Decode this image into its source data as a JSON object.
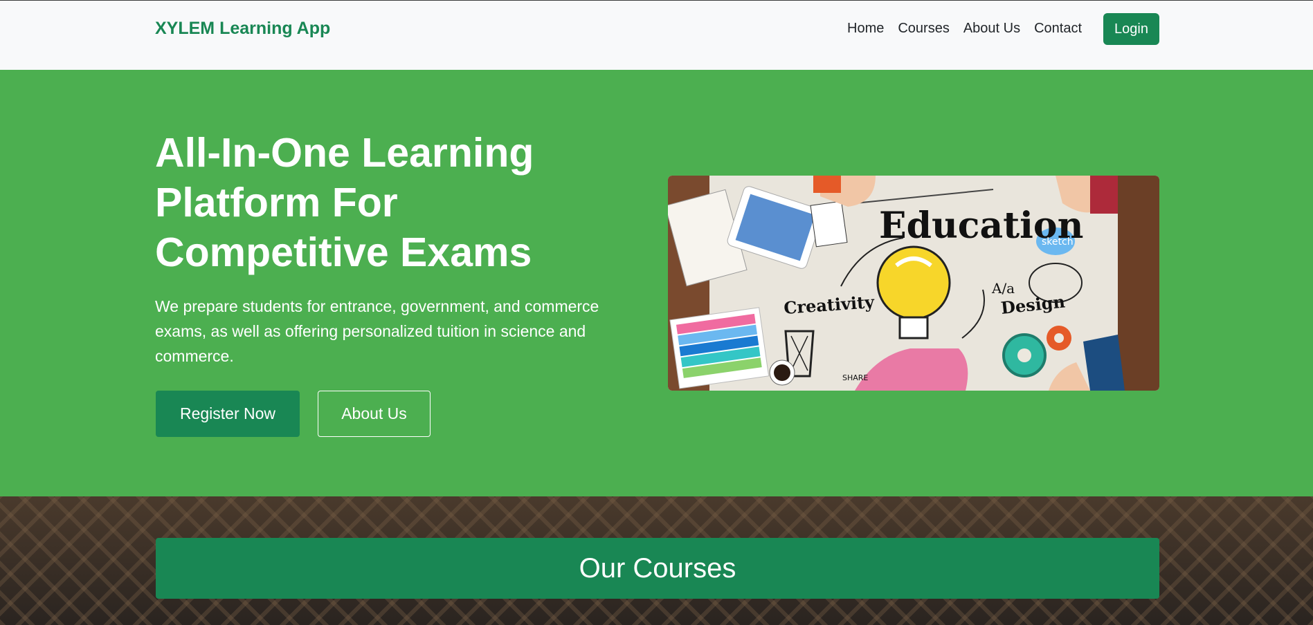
{
  "navbar": {
    "brand": "XYLEM Learning App",
    "links": [
      "Home",
      "Courses",
      "About Us",
      "Contact"
    ],
    "login_label": "Login"
  },
  "hero": {
    "title": "All-In-One Learning Platform For Competitive Exams",
    "description": "We prepare students for entrance, government, and commerce exams, as well as offering personalized tuition in science and commerce.",
    "register_label": "Register Now",
    "about_label": "About Us",
    "image": {
      "heading": "Education",
      "labels": [
        "Creativity",
        "Design",
        "sketch",
        "A/a",
        "SHARE"
      ]
    }
  },
  "courses": {
    "heading": "Our Courses"
  },
  "colors": {
    "brand_green": "#198754",
    "hero_green": "#4caf50",
    "navbar_bg": "#f8f9fa"
  }
}
